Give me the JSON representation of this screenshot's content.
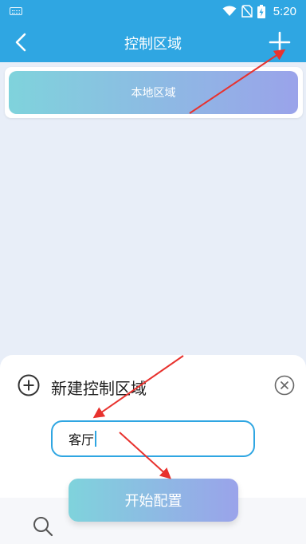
{
  "status_bar": {
    "time": "5:20",
    "icons": [
      "keyboard-icon",
      "wifi-icon",
      "no-sim-icon",
      "battery-charging-icon"
    ]
  },
  "header": {
    "title": "控制区域",
    "back_icon": "chevron-left-icon",
    "add_icon": "plus-icon"
  },
  "zones": [
    {
      "label": "本地区域"
    }
  ],
  "dialog": {
    "title": "新建控制区域",
    "input_value": "客厅",
    "start_button_label": "开始配置",
    "add_icon": "add-circle-icon",
    "close_icon": "close-circle-icon"
  },
  "bottom_nav": {
    "search_icon": "search-icon"
  },
  "colors": {
    "primary": "#2fa6e2",
    "gradient_start": "#7fd3dc",
    "gradient_end": "#9aa3ea",
    "annotation": "#e8322e"
  }
}
